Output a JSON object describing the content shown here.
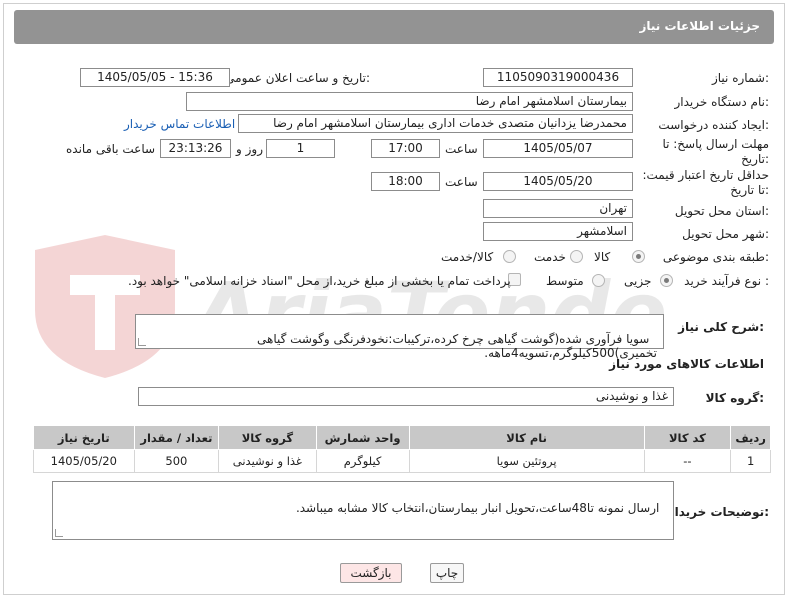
{
  "header": {
    "title": "جزئیات اطلاعات نیاز"
  },
  "watermark": {
    "text": "AriaTender.neT"
  },
  "fields": {
    "need_number": {
      "label": "شماره نیاز:",
      "value": "1105090319000436"
    },
    "announce_datetime": {
      "label": "تاریخ و ساعت اعلان عمومی:",
      "value": "1405/05/05 - 15:36"
    },
    "buyer_org": {
      "label": "نام دستگاه خریدار:",
      "value": "بیمارستان اسلامشهر   امام رضا"
    },
    "requester": {
      "label": "ایجاد کننده درخواست:",
      "value": "محمدرضا یزدانیان متصدی خدمات اداری بیمارستان اسلامشهر   امام رضا",
      "link": "اطلاعات تماس خریدار"
    },
    "response_deadline": {
      "label": "مهلت ارسال پاسخ: تا تاریخ:",
      "date": "1405/05/07",
      "time_label": "ساعت",
      "time": "17:00",
      "days": "1",
      "days_label": "روز و",
      "remaining": "23:13:26",
      "remaining_label": "ساعت باقی مانده"
    },
    "price_validity": {
      "label": "حداقل تاریخ اعتبار قیمت: تا تاریخ:",
      "date": "1405/05/20",
      "time_label": "ساعت",
      "time": "18:00"
    },
    "delivery_province": {
      "label": "استان محل تحویل:",
      "value": "تهران"
    },
    "delivery_city": {
      "label": "شهر محل تحویل:",
      "value": "اسلامشهر"
    },
    "category": {
      "label": "طبقه بندی موضوعی:",
      "options": [
        "کالا",
        "خدمت",
        "کالا/خدمت"
      ],
      "selected": "کالا"
    },
    "process_type": {
      "label": "نوع فرآیند خرید :",
      "options": [
        "جزیی",
        "متوسط"
      ],
      "selected": "جزیی",
      "payment_note": "پرداخت تمام یا بخشی از مبلغ خرید،از محل \"اسناد خزانه اسلامی\" خواهد بود."
    }
  },
  "description": {
    "label": "شرح کلی نیاز:",
    "value": "سویا فرآوری شده(گوشت گیاهی چرخ کرده،ترکیبات:نخودفرنگی وگوشت گیاهی تخمیری)500کیلوگرم،تسویه4ماهه."
  },
  "goods_info": {
    "title": "اطلاعات کالاهای مورد نیاز",
    "group_label": "گروه کالا:",
    "group_value": "غذا و نوشیدنی"
  },
  "table": {
    "columns": [
      "ردیف",
      "کد کالا",
      "نام کالا",
      "واحد شمارش",
      "گروه کالا",
      "تعداد / مقدار",
      "تاریخ نیاز"
    ],
    "rows": [
      [
        "1",
        "--",
        "پروتئین سویا",
        "کیلوگرم",
        "غذا و نوشیدنی",
        "500",
        "1405/05/20"
      ]
    ]
  },
  "buyer_notes": {
    "label": "توضیحات خریدار:",
    "value": "ارسال نمونه تا48ساعت،تحویل انبار بیمارستان،انتخاب کالا مشابه میباشد."
  },
  "buttons": {
    "print": "چاپ",
    "back": "بازگشت"
  },
  "colors": {
    "header": "#939393",
    "link": "#1a5fb4",
    "back_button": "#fde6e6",
    "table_header": "#c8c8c8"
  }
}
